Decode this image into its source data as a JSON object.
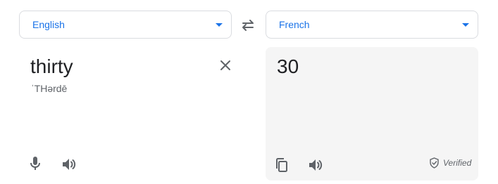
{
  "source_language": {
    "label": "English"
  },
  "target_language": {
    "label": "French"
  },
  "source": {
    "text": "thirty",
    "phonetic": "ˈTHərdē"
  },
  "target": {
    "text": "30",
    "verified_label": "Verified"
  },
  "icons": {
    "swap": "swap-horizontal-icon",
    "clear": "close-icon",
    "mic": "microphone-icon",
    "source_listen": "speaker-icon",
    "copy": "copy-icon",
    "target_listen": "speaker-icon",
    "verified": "shield-check-icon"
  },
  "colors": {
    "accent": "#1a73e8",
    "icon": "#5f6368",
    "text": "#202124",
    "target_panel_bg": "#f5f5f5",
    "border": "#dadce0"
  }
}
